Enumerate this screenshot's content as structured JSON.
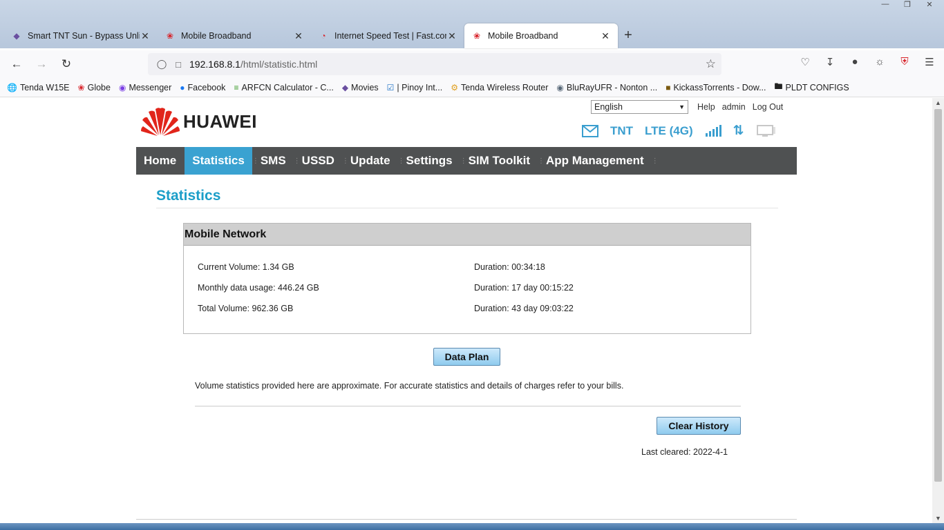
{
  "browser": {
    "tabs": [
      {
        "title": "Smart TNT Sun - Bypass Unlida",
        "favicon": "shield-icon",
        "favicon_color": "#6a4fa0"
      },
      {
        "title": "Mobile Broadband",
        "favicon": "huawei-icon",
        "favicon_color": "#d8232a"
      },
      {
        "title": "Internet Speed Test | Fast.com",
        "favicon": "speedometer-icon",
        "favicon_color": "#d8232a"
      },
      {
        "title": "Mobile Broadband",
        "favicon": "huawei-icon",
        "favicon_color": "#d8232a"
      }
    ],
    "active_tab_index": 3,
    "url_host": "192.168.8.1",
    "url_path": "/html/statistic.html",
    "bookmarks": [
      {
        "label": "Tenda W15E",
        "icon": "globe-icon"
      },
      {
        "label": "Globe",
        "icon": "huawei-icon"
      },
      {
        "label": "Messenger",
        "icon": "messenger-icon"
      },
      {
        "label": "Facebook",
        "icon": "facebook-icon"
      },
      {
        "label": "ARFCN Calculator - C...",
        "icon": "wifi-icon"
      },
      {
        "label": "Movies",
        "icon": "shield-icon"
      },
      {
        "label": "| Pinoy Int...",
        "icon": "checkbox-icon"
      },
      {
        "label": "Tenda Wireless Router",
        "icon": "gear-icon"
      },
      {
        "label": "BluRayUFR - Nonton ...",
        "icon": "disc-icon"
      },
      {
        "label": "KickassTorrents - Dow...",
        "icon": "k-icon"
      },
      {
        "label": "PLDT CONFIGS",
        "icon": "folder-icon"
      }
    ]
  },
  "header": {
    "brand": "HUAWEI",
    "language": "English",
    "links": {
      "help": "Help",
      "user": "admin",
      "logout": "Log Out"
    },
    "status": {
      "carrier": "TNT",
      "network": "LTE (4G)"
    }
  },
  "menu": {
    "items": [
      "Home",
      "Statistics",
      "SMS",
      "USSD",
      "Update",
      "Settings",
      "SIM Toolkit",
      "App Management"
    ],
    "active_index": 1
  },
  "page": {
    "title": "Statistics",
    "panel_title": "Mobile Network",
    "stats": {
      "current_volume": "Current Volume: 1.34 GB",
      "current_duration": "Duration: 00:34:18",
      "monthly_usage": "Monthly data usage: 446.24 GB",
      "monthly_duration": "Duration: 17 day 00:15:22",
      "total_volume": "Total Volume: 962.36 GB",
      "total_duration": "Duration: 43 day 09:03:22"
    },
    "data_plan_button": "Data Plan",
    "note": "Volume statistics provided here are approximate. For accurate statistics and details of charges refer to your bills.",
    "clear_history_button": "Clear History",
    "last_cleared": "Last cleared: 2022-4-1"
  },
  "colors": {
    "accent": "#3aa2d1",
    "menu_bg": "#4f5152",
    "title": "#1c9ec8",
    "huawei_red": "#e1251b"
  }
}
